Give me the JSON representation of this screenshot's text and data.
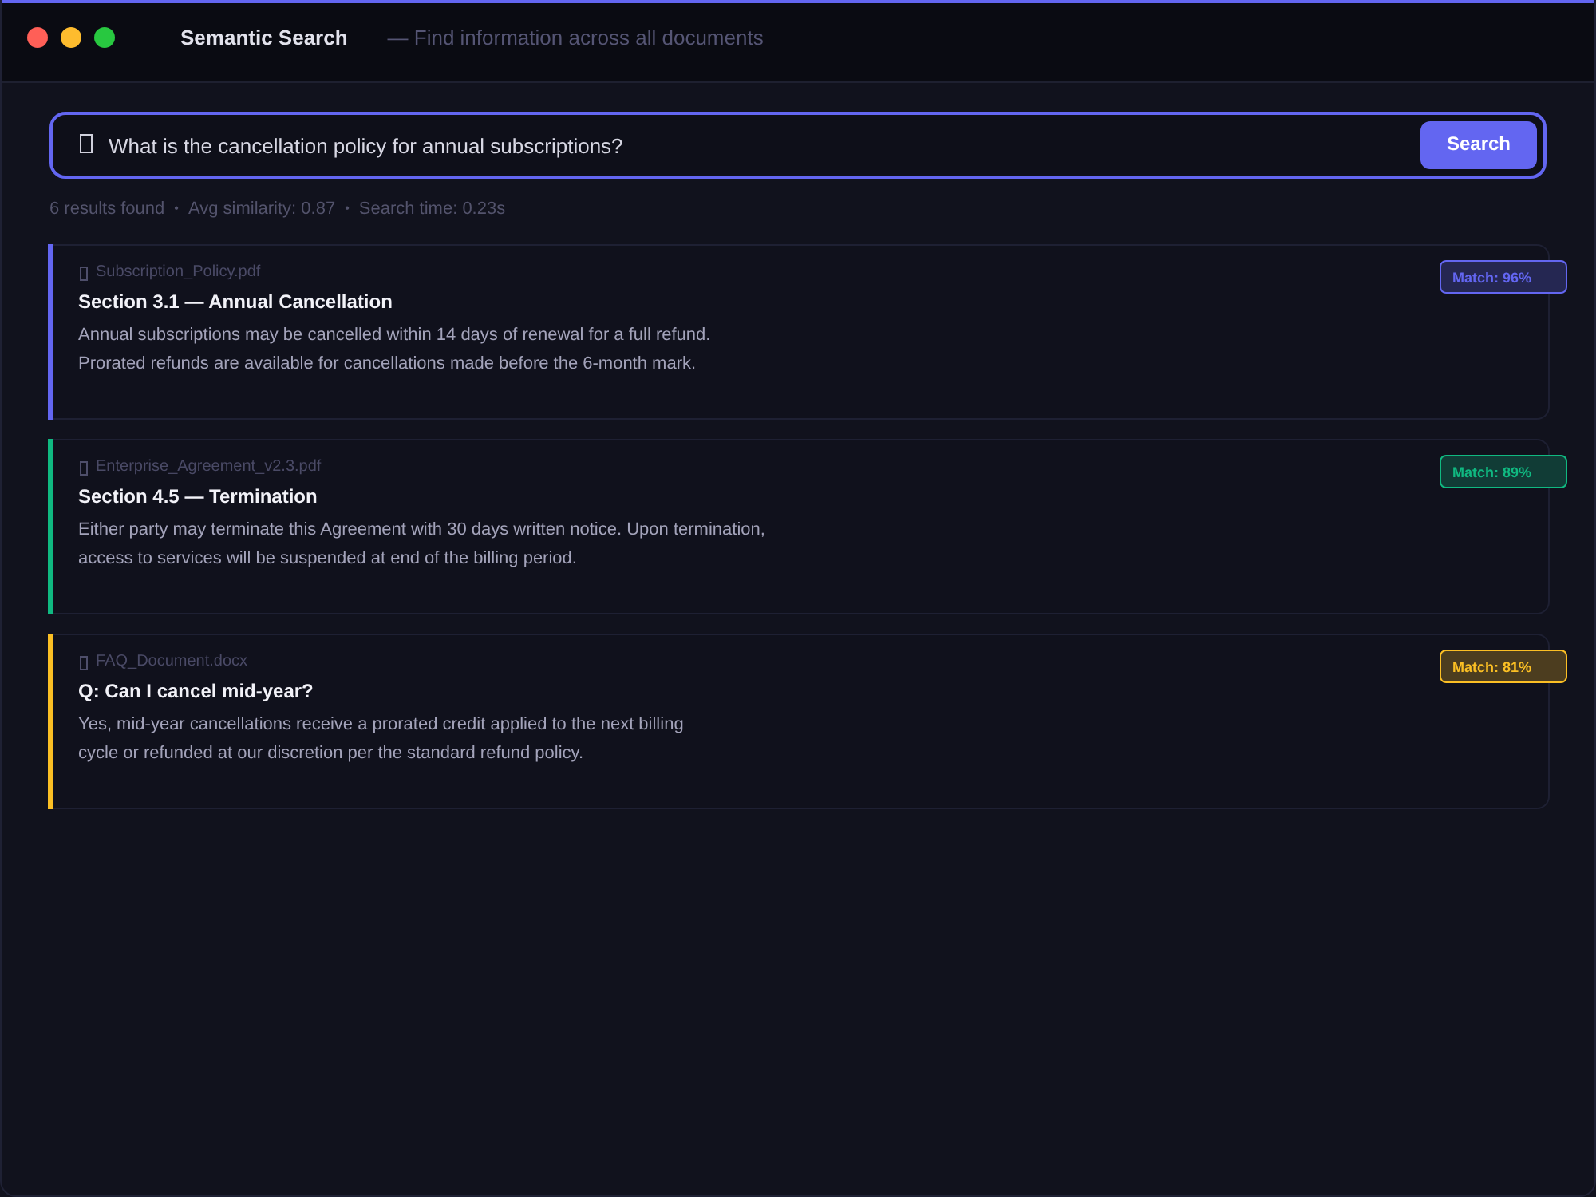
{
  "window": {
    "title": "Semantic Search",
    "subtitle": "— Find information across all documents",
    "controls": [
      {
        "kind": "close"
      },
      {
        "kind": "minimize"
      },
      {
        "kind": "maximize"
      }
    ]
  },
  "search": {
    "value": "What is the cancellation policy for annual subscriptions?",
    "button": "Search"
  },
  "stats": [
    {
      "text": "6 results found"
    },
    {
      "separator": "•",
      "text": "Avg similarity: 0.87"
    },
    {
      "separator": "•",
      "text": "Search time: 0.23s"
    }
  ],
  "results": [
    {
      "file": "Subscription_Policy.pdf",
      "title": "Section 3.1 — Annual Cancellation",
      "lines": [
        "Annual subscriptions may be cancelled within 14 days of renewal for a full refund.",
        "Prorated refunds are available for cancellations made before the 6-month mark."
      ],
      "match": "Match: 96%",
      "color": "#6366f1"
    },
    {
      "file": "Enterprise_Agreement_v2.3.pdf",
      "title": "Section 4.5 — Termination",
      "lines": [
        "Either party may terminate this Agreement with 30 days written notice. Upon termination,",
        "access to services will be suspended at end of the billing period."
      ],
      "match": "Match: 89%",
      "color": "#10b981"
    },
    {
      "file": "FAQ_Document.docx",
      "title": "Q: Can I cancel mid-year?",
      "lines": [
        "Yes, mid-year cancellations receive a prorated credit applied to the next billing",
        "cycle or refunded at our discretion per the standard refund policy."
      ],
      "match": "Match: 81%",
      "color": "#fbbf24"
    }
  ]
}
